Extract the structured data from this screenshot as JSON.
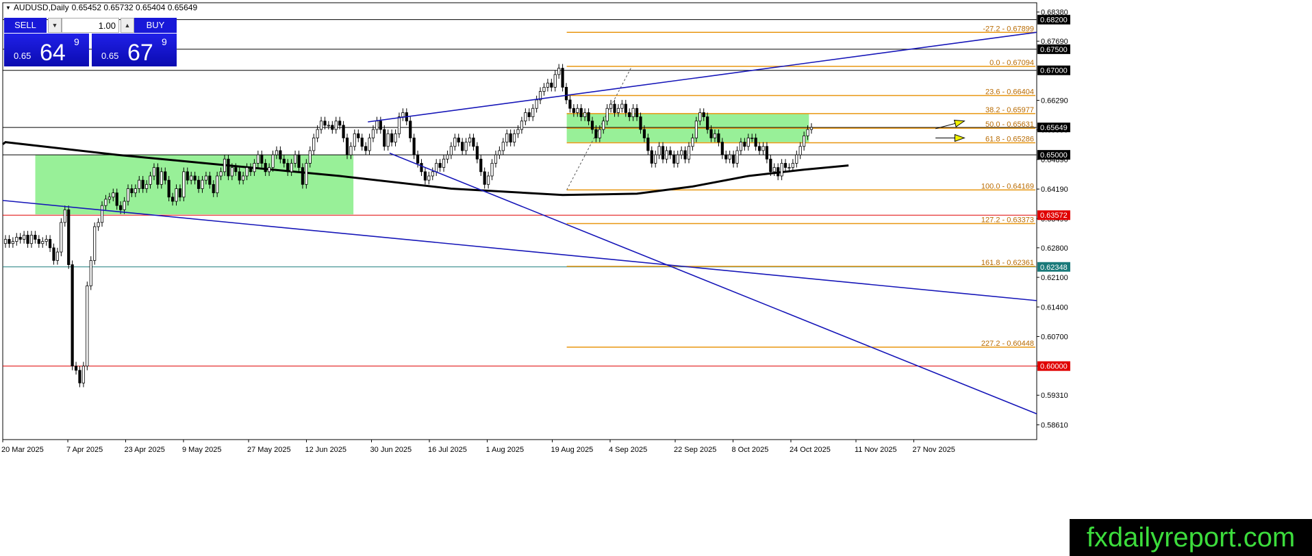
{
  "header": {
    "symbol": "AUDUSD,Daily",
    "ohlc": "0.65452 0.65732 0.65404 0.65649"
  },
  "trade_panel": {
    "sell_label": "SELL",
    "buy_label": "BUY",
    "lot": "1.00",
    "sell_prefix": "0.65",
    "sell_big": "64",
    "sell_sup": "9",
    "buy_prefix": "0.65",
    "buy_big": "67",
    "buy_sup": "9"
  },
  "watermark": "fxdailyreport.com",
  "colors": {
    "bull": "#ffffff",
    "bear": "#000000",
    "ma": "#000000",
    "fib": "#e8960f",
    "trendline": "#1515b8",
    "zone": "#98f098",
    "price_label_bg": "#000000",
    "red_label_bg": "#e00000",
    "teal_line": "#1a7a7a",
    "arrow": "#f0f000"
  },
  "chart_data": {
    "type": "candlestick",
    "title": "AUDUSD,Daily",
    "ylim": [
      0.5826,
      0.686
    ],
    "x_start": "2025-03-20",
    "x_end": "2025-12-31",
    "y_ticks": [
      "0.68380",
      "0.67690",
      "0.66290",
      "0.65590",
      "0.64890",
      "0.64190",
      "0.63490",
      "0.62800",
      "0.62100",
      "0.61400",
      "0.60700",
      "0.60000",
      "0.59310",
      "0.58610"
    ],
    "x_ticks": [
      {
        "label": "20 Mar 2025",
        "date": "2025-03-20"
      },
      {
        "label": "7 Apr 2025",
        "date": "2025-04-07"
      },
      {
        "label": "23 Apr 2025",
        "date": "2025-04-23"
      },
      {
        "label": "9 May 2025",
        "date": "2025-05-09"
      },
      {
        "label": "27 May 2025",
        "date": "2025-05-27"
      },
      {
        "label": "12 Jun 2025",
        "date": "2025-06-12"
      },
      {
        "label": "30 Jun 2025",
        "date": "2025-06-30"
      },
      {
        "label": "16 Jul 2025",
        "date": "2025-07-16"
      },
      {
        "label": "1 Aug 2025",
        "date": "2025-08-01"
      },
      {
        "label": "19 Aug 2025",
        "date": "2025-08-19"
      },
      {
        "label": "4 Sep 2025",
        "date": "2025-09-04"
      },
      {
        "label": "22 Sep 2025",
        "date": "2025-09-22"
      },
      {
        "label": "8 Oct 2025",
        "date": "2025-10-08"
      },
      {
        "label": "24 Oct 2025",
        "date": "2025-10-24"
      },
      {
        "label": "11 Nov 2025",
        "date": "2025-11-11"
      },
      {
        "label": "27 Nov 2025",
        "date": "2025-11-27"
      }
    ],
    "closes": [
      0.63,
      0.629,
      0.6295,
      0.6305,
      0.63,
      0.631,
      0.629,
      0.631,
      0.63,
      0.629,
      0.6295,
      0.63,
      0.628,
      0.625,
      0.627,
      0.634,
      0.637,
      0.624,
      0.6,
      0.599,
      0.596,
      0.6,
      0.619,
      0.625,
      0.633,
      0.634,
      0.638,
      0.6395,
      0.64,
      0.641,
      0.638,
      0.637,
      0.639,
      0.642,
      0.641,
      0.642,
      0.644,
      0.642,
      0.643,
      0.645,
      0.647,
      0.643,
      0.646,
      0.644,
      0.64,
      0.639,
      0.642,
      0.64,
      0.646,
      0.644,
      0.645,
      0.644,
      0.642,
      0.644,
      0.645,
      0.643,
      0.641,
      0.645,
      0.646,
      0.649,
      0.645,
      0.647,
      0.646,
      0.644,
      0.645,
      0.647,
      0.646,
      0.648,
      0.65,
      0.648,
      0.646,
      0.647,
      0.65,
      0.651,
      0.649,
      0.648,
      0.646,
      0.648,
      0.65,
      0.647,
      0.643,
      0.648,
      0.651,
      0.654,
      0.656,
      0.658,
      0.657,
      0.657,
      0.656,
      0.658,
      0.657,
      0.654,
      0.65,
      0.652,
      0.655,
      0.654,
      0.652,
      0.651,
      0.654,
      0.656,
      0.658,
      0.656,
      0.652,
      0.655,
      0.653,
      0.655,
      0.659,
      0.66,
      0.658,
      0.654,
      0.65,
      0.648,
      0.646,
      0.644,
      0.645,
      0.646,
      0.648,
      0.647,
      0.649,
      0.65,
      0.652,
      0.654,
      0.653,
      0.651,
      0.653,
      0.654,
      0.652,
      0.649,
      0.646,
      0.643,
      0.645,
      0.648,
      0.65,
      0.651,
      0.653,
      0.655,
      0.653,
      0.655,
      0.656,
      0.658,
      0.66,
      0.659,
      0.661,
      0.663,
      0.665,
      0.666,
      0.667,
      0.666,
      0.669,
      0.6705,
      0.666,
      0.663,
      0.661,
      0.66,
      0.661,
      0.659,
      0.66,
      0.658,
      0.656,
      0.654,
      0.656,
      0.658,
      0.661,
      0.662,
      0.66,
      0.661,
      0.662,
      0.66,
      0.659,
      0.661,
      0.659,
      0.656,
      0.654,
      0.651,
      0.648,
      0.65,
      0.652,
      0.649,
      0.651,
      0.65,
      0.648,
      0.65,
      0.651,
      0.649,
      0.652,
      0.654,
      0.658,
      0.66,
      0.659,
      0.656,
      0.654,
      0.655,
      0.653,
      0.65,
      0.649,
      0.65,
      0.648,
      0.651,
      0.653,
      0.652,
      0.654,
      0.654,
      0.652,
      0.651,
      0.652,
      0.649,
      0.646,
      0.647,
      0.645,
      0.648,
      0.647,
      0.647,
      0.648,
      0.65,
      0.652,
      0.6545,
      0.656,
      0.6565
    ],
    "moving_average": {
      "points": [
        [
          0,
          0.653
        ],
        [
          30,
          0.65
        ],
        [
          60,
          0.6475
        ],
        [
          90,
          0.645
        ],
        [
          120,
          0.642
        ],
        [
          150,
          0.6405
        ],
        [
          170,
          0.6408
        ],
        [
          185,
          0.6425
        ],
        [
          200,
          0.645
        ],
        [
          215,
          0.6465
        ],
        [
          227,
          0.6475
        ]
      ]
    },
    "fibonacci": [
      {
        "label": "-27.2 - 0.67899",
        "value": 0.67899
      },
      {
        "label": "0.0 - 0.67094",
        "value": 0.67094
      },
      {
        "label": "23.6 - 0.66404",
        "value": 0.66404
      },
      {
        "label": "38.2 - 0.65977",
        "value": 0.65977
      },
      {
        "label": "50.0 - 0.65631",
        "value": 0.65631
      },
      {
        "label": "61.8 - 0.65286",
        "value": 0.65286
      },
      {
        "label": "100.0 - 0.64169",
        "value": 0.64169
      },
      {
        "label": "127.2 - 0.63373",
        "value": 0.63373
      },
      {
        "label": "161.8 - 0.62361",
        "value": 0.62361
      },
      {
        "label": "227.2 - 0.60448",
        "value": 0.60448
      }
    ],
    "fib_start_date": "2025-08-23",
    "horizontal_levels": [
      {
        "label": "0.68200",
        "value": 0.682,
        "color": "#000000",
        "from_date": "2025-03-20"
      },
      {
        "label": "0.67500",
        "value": 0.675,
        "color": "#000000",
        "from_date": "2025-03-20"
      },
      {
        "label": "0.67000",
        "value": 0.67,
        "color": "#000000",
        "from_date": "2025-03-20"
      },
      {
        "label": "0.65649",
        "value": 0.65649,
        "color": "#000000",
        "from_date": "2025-03-20"
      },
      {
        "label": "0.65000",
        "value": 0.65,
        "color": "#000000",
        "from_date": "2025-03-20"
      },
      {
        "label": "0.63572",
        "value": 0.63572,
        "color": "#e00000",
        "from_date": "2025-03-20"
      },
      {
        "label": "0.62348",
        "value": 0.62348,
        "color": "#1a7a7a",
        "from_date": "2025-03-20"
      },
      {
        "label": "0.60000",
        "value": 0.6,
        "color": "#e00000",
        "from_date": "2025-03-20"
      }
    ],
    "zones": [
      {
        "from_date": "2025-03-29",
        "to_date": "2025-06-25",
        "top": 0.65,
        "bottom": 0.6359
      },
      {
        "from_date": "2025-08-23",
        "to_date": "2025-10-29",
        "top": 0.6598,
        "bottom": 0.653
      }
    ],
    "trendlines": [
      {
        "from_date": "2025-03-20",
        "from_value": 0.6392,
        "to_date": "2025-12-31",
        "to_value": 0.6155
      },
      {
        "from_date": "2025-06-29",
        "from_value": 0.6578,
        "to_date": "2025-12-31",
        "to_value": 0.679
      },
      {
        "from_date": "2025-07-05",
        "from_value": 0.6504,
        "to_date": "2025-12-31",
        "to_value": 0.5887
      }
    ],
    "arrows": [
      {
        "from_date": "2025-12-03",
        "from_value": 0.6562,
        "to_date": "2025-12-11",
        "to_value": 0.658
      },
      {
        "from_date": "2025-12-03",
        "from_value": 0.654,
        "to_date": "2025-12-11",
        "to_value": 0.654
      }
    ]
  }
}
